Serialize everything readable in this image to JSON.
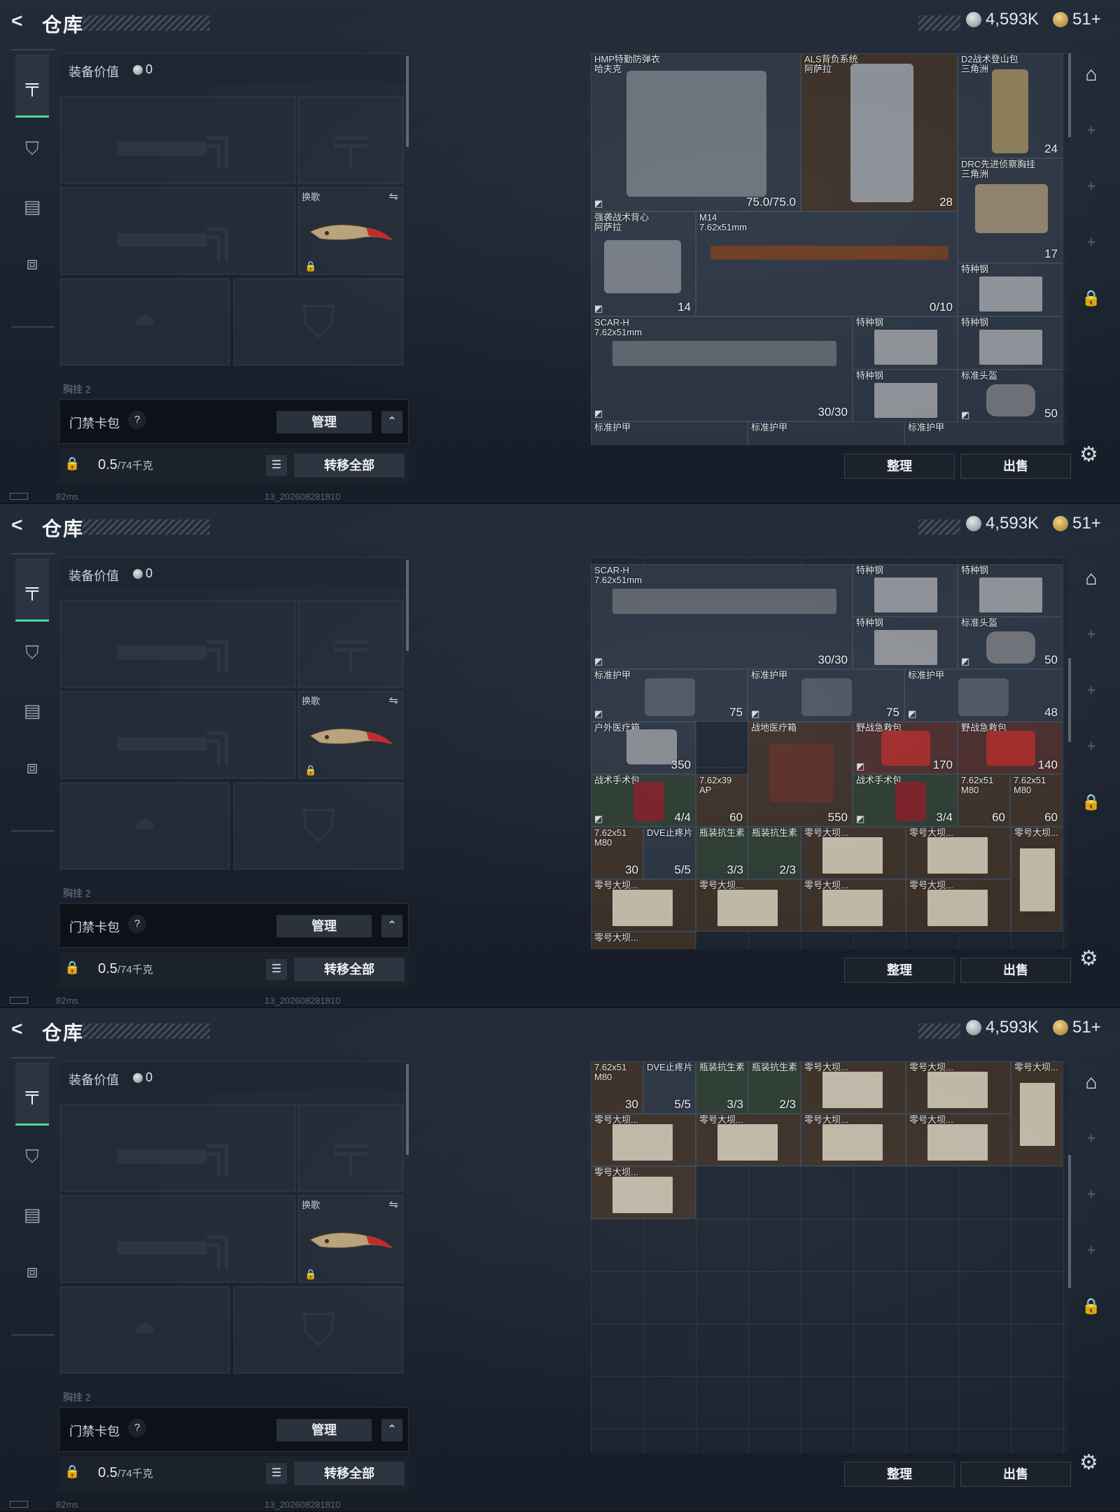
{
  "header": {
    "back_icon": "chevron-left-icon",
    "title": "仓库",
    "silver": "4,593K",
    "gold": "51+"
  },
  "left_nav": {
    "tabs": [
      {
        "icon": "pistol-icon",
        "active": true
      },
      {
        "icon": "armor-icon",
        "active": false
      },
      {
        "icon": "clipboard-icon",
        "active": false
      },
      {
        "icon": "toolbox-icon",
        "active": false
      }
    ]
  },
  "equipment": {
    "value_label": "装备价值",
    "value": "0",
    "swap_label": "换歌",
    "chest_label": "胸挂 2"
  },
  "card_bar": {
    "label": "门禁卡包",
    "help": "?",
    "manage": "管理",
    "collapse": "^"
  },
  "weight_bar": {
    "current": "0.5",
    "max": "/74千克",
    "transfer_all": "转移全部"
  },
  "status": {
    "ping": "82ms",
    "version": "13_202608281810"
  },
  "actions": {
    "sort": "整理",
    "sell": "出售"
  },
  "items": {
    "hmp": {
      "name": "HMP特勤防弹衣\n哈夫克",
      "count": "75.0/75.0"
    },
    "als": {
      "name": "ALS背负系统\n阿萨拉",
      "count": "28"
    },
    "d2": {
      "name": "D2战术登山包\n三角洲",
      "count": "24"
    },
    "drc": {
      "name": "DRC先进侦察胸挂\n三角洲",
      "count": "17"
    },
    "qiangxi": {
      "name": "强袭战术背心\n阿萨拉",
      "count": "14"
    },
    "m14": {
      "name": "M14\n7.62x51mm",
      "count": "0/10"
    },
    "scar": {
      "name": "SCAR-H\n7.62x51mm",
      "count": "30/30"
    },
    "teizhong": "特种钢",
    "helmet": {
      "name": "标准头盔",
      "count": "50"
    },
    "armor1": {
      "name": "标准护甲",
      "count": "75"
    },
    "armor2": {
      "name": "标准护甲",
      "count": "75"
    },
    "armor3": {
      "name": "标准护甲",
      "count": "48"
    },
    "medkit_out": {
      "name": "户外医疗箱",
      "count": "350"
    },
    "medkit_field": {
      "name": "战地医疗箱",
      "count": "550"
    },
    "aid1": {
      "name": "野战急救包",
      "count": "170"
    },
    "aid2": {
      "name": "野战急救包",
      "count": "140"
    },
    "surg1": {
      "name": "战术手术包",
      "count": "4/4"
    },
    "surg2": {
      "name": "战术手术包",
      "count": "3/4"
    },
    "ap": {
      "name": "7.62x39\nAP",
      "count": "60"
    },
    "m80a": {
      "name": "7.62x51\nM80",
      "count": "60"
    },
    "m80b": {
      "name": "7.62x51\nM80",
      "count": "60"
    },
    "m80c": {
      "name": "7.62x51\nM80",
      "count": "30"
    },
    "dve": {
      "name": "DVE止疼片",
      "count": "5/5"
    },
    "anti1": {
      "name": "瓶装抗生素",
      "count": "3/3"
    },
    "anti2": {
      "name": "瓶装抗生素",
      "count": "2/3"
    },
    "map": "零号大坝..."
  },
  "colors": {
    "accent": "#4fd39a",
    "background": "#1a2230"
  }
}
